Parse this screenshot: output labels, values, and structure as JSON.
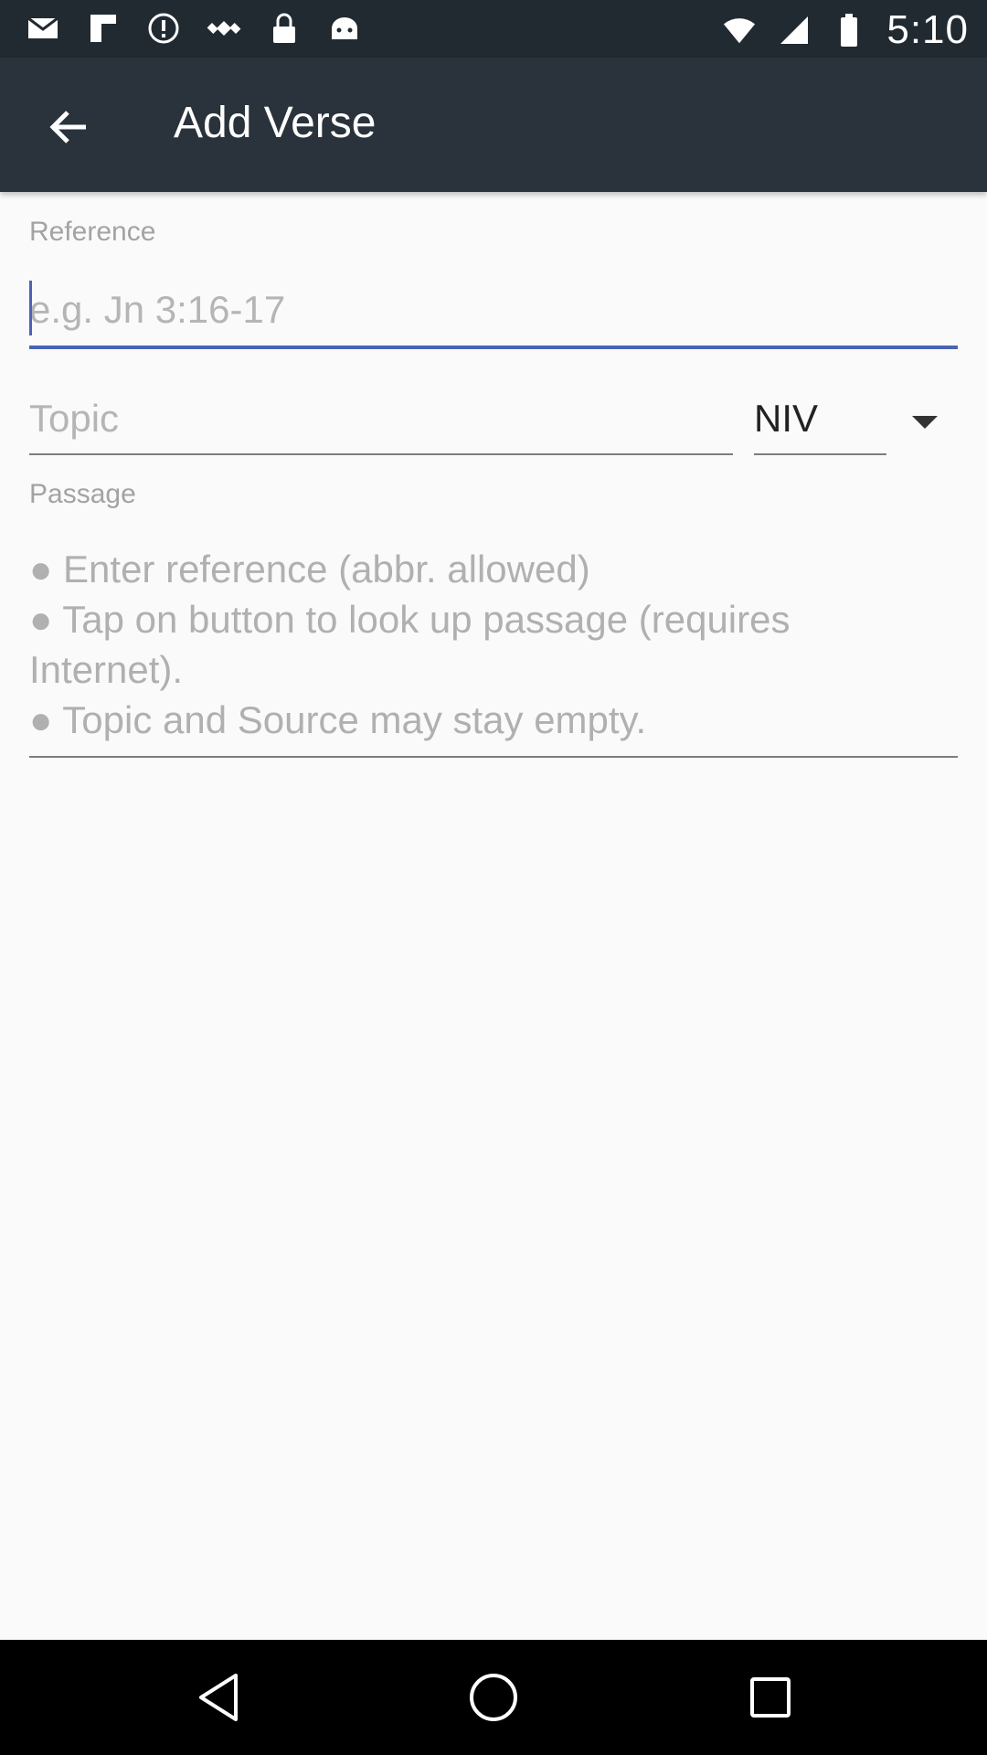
{
  "status_bar": {
    "time": "5:10",
    "left_icons": [
      "mail-icon",
      "flipboard-icon",
      "alert-circle-icon",
      "fake-gps-icon",
      "lock-icon",
      "android-icon"
    ],
    "right_icons": [
      "wifi-icon",
      "signal-icon",
      "battery-icon"
    ]
  },
  "app_bar": {
    "title": "Add Verse",
    "back_icon": "arrow-back-icon"
  },
  "form": {
    "reference_label": "Reference",
    "reference_placeholder": "e.g. Jn 3:16-17",
    "topic_placeholder": "Topic",
    "version_value": "NIV",
    "passage_label": "Passage",
    "passage_hint": [
      "● Enter reference (abbr. allowed)",
      "● Tap on button to look up passage (requires",
      "Internet).",
      "● Topic and Source may stay empty."
    ]
  },
  "nav_bar": {
    "buttons": [
      "back-triangle-icon",
      "home-circle-icon",
      "recents-square-icon"
    ]
  },
  "colors": {
    "status_bar_bg": "#222a31",
    "app_bar_bg": "#2a333b",
    "accent": "#4a63b5",
    "background": "#fafafa"
  }
}
